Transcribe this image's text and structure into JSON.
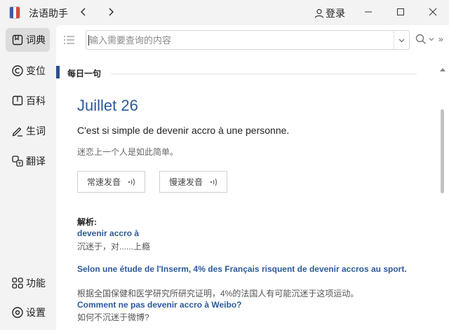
{
  "app": {
    "title": "法语助手",
    "login_label": "登录"
  },
  "sidebar": {
    "items": [
      {
        "label": "词典",
        "icon": "book-icon"
      },
      {
        "label": "变位",
        "icon": "conjugation-icon"
      },
      {
        "label": "百科",
        "icon": "encyclopedia-icon"
      },
      {
        "label": "生词",
        "icon": "pen-icon"
      },
      {
        "label": "翻译",
        "icon": "translate-icon"
      }
    ],
    "bottom_items": [
      {
        "label": "功能",
        "icon": "grid-icon"
      },
      {
        "label": "设置",
        "icon": "gear-icon"
      }
    ]
  },
  "search": {
    "placeholder": "输入需要查询的内容",
    "value": "",
    "more_label": "»"
  },
  "daily": {
    "section_title": "每日一句",
    "date": "Juillet 26",
    "sentence_fr": "C'est si simple de devenir accro à une personne.",
    "sentence_zh": "迷恋上一个人是如此简单。",
    "normal_audio_label": "常速发音",
    "slow_audio_label": "慢速发音"
  },
  "analysis": {
    "label": "解析:",
    "entries": [
      {
        "fr": "devenir accro à",
        "zh": "沉迷于，对......上瘾"
      },
      {
        "fr": "Selon une étude de l'Inserm, 4% des Français risquent de devenir accros au sport.",
        "zh": "根据全国保健和医学研究所研究证明，4%的法国人有可能沉迷于这项运动。"
      },
      {
        "fr": "Comment ne pas devenir accro à Weibo?",
        "zh": "如何不沉迷于微博?"
      }
    ]
  },
  "colors": {
    "accent": "#2c5a9a",
    "section_bar": "#2c4f8c",
    "sidebar_bg": "#f3f3f3",
    "active_item_bg": "#dcdcdc"
  }
}
